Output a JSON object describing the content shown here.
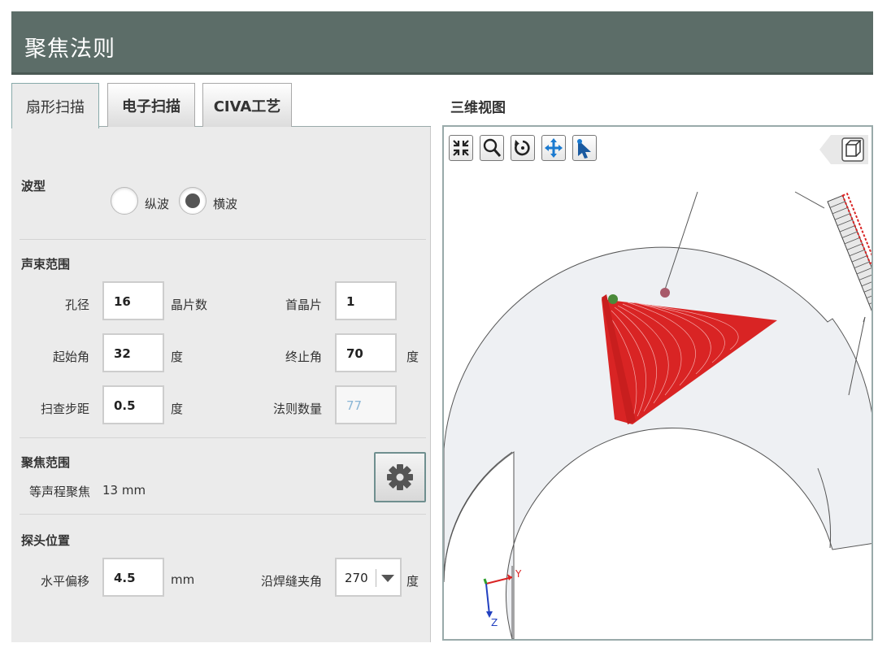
{
  "window": {
    "title": "聚焦法则"
  },
  "tabs": [
    {
      "label": "扇形扫描",
      "active": true
    },
    {
      "label": "电子扫描",
      "active": false
    },
    {
      "label": "CIVA工艺",
      "active": false
    }
  ],
  "wave": {
    "label": "波型",
    "options": [
      {
        "label": "纵波",
        "checked": false
      },
      {
        "label": "横波",
        "checked": true
      }
    ]
  },
  "beam": {
    "label": "声束范围",
    "aperture_label": "孔径",
    "aperture_value": "16",
    "aperture_unit": "晶片数",
    "first_label": "首晶片",
    "first_value": "1",
    "start_label": "起始角",
    "start_value": "32",
    "start_unit": "度",
    "end_label": "终止角",
    "end_value": "70",
    "end_unit": "度",
    "step_label": "扫查步距",
    "step_value": "0.5",
    "step_unit": "度",
    "count_label": "法则数量",
    "count_value": "77"
  },
  "focus": {
    "label": "聚焦范围",
    "depth_label": "等声程聚焦",
    "depth_value": "13 mm"
  },
  "probe": {
    "label": "探头位置",
    "offset_label": "水平偏移",
    "offset_value": "4.5",
    "offset_unit": "mm",
    "angle_label": "沿焊缝夹角",
    "angle_value": "270",
    "angle_unit": "度"
  },
  "view3d": {
    "title": "三维视图",
    "toolbar": [
      "fit-icon",
      "zoom-icon",
      "rotate-icon",
      "pan-icon",
      "select-icon"
    ],
    "axes": {
      "y": "Y",
      "z": "Z"
    },
    "colors": {
      "beam": "#d92424",
      "part": "#eef0f3",
      "probe": "#e8e8e8",
      "marker_green": "#4a8a3a",
      "marker_red": "#a85a6a"
    }
  }
}
